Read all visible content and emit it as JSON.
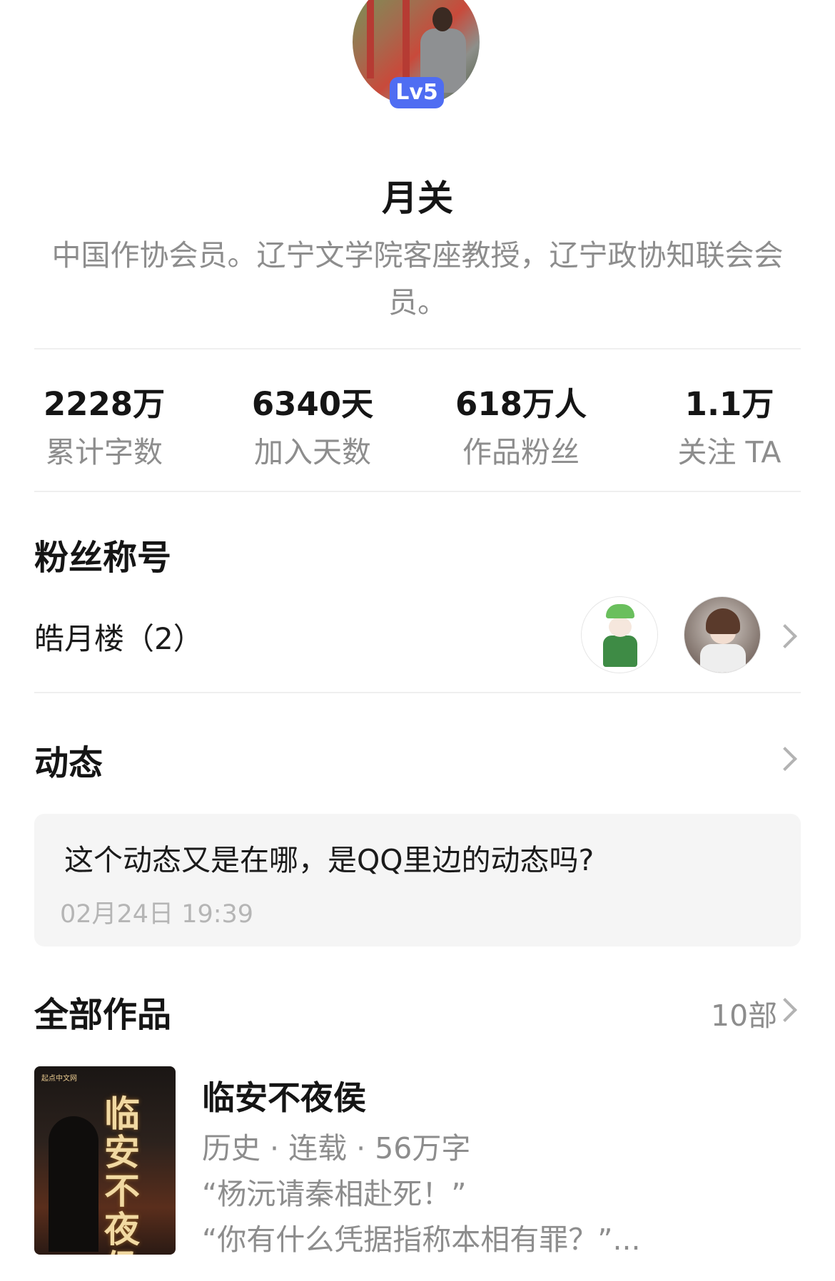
{
  "profile": {
    "level_badge": "Lv5",
    "name": "月关",
    "bio": "中国作协会员。辽宁文学院客座教授，辽宁政协知联会会员。"
  },
  "stats": [
    {
      "value": "2228万",
      "label": "累计字数"
    },
    {
      "value": "6340天",
      "label": "加入天数"
    },
    {
      "value": "618万人",
      "label": "作品粉丝"
    },
    {
      "value": "1.1万",
      "label": "关注 TA"
    }
  ],
  "fan_title": {
    "heading": "粉丝称号",
    "name": "皓月楼（2）"
  },
  "moments": {
    "heading": "动态",
    "post_text": "这个动态又是在哪，是QQ里边的动态吗?",
    "post_time": "02月24日 19:39"
  },
  "works": {
    "heading": "全部作品",
    "count": "10部",
    "book": {
      "cover_tag": "起点中文网",
      "cover_title": "临安不夜侯",
      "title": "临安不夜侯",
      "meta": "历史 · 连载 · 56万字",
      "excerpt_line1": "“杨沅请秦相赴死！”",
      "excerpt_line2": "“你有什么凭据指称本相有罪？”..."
    }
  },
  "icons": {
    "chevron": "chevron-right-icon"
  },
  "colors": {
    "badge_blue": "#4f6df2",
    "card_bg": "#f5f5f5",
    "secondary_text": "#8d8d8d"
  }
}
